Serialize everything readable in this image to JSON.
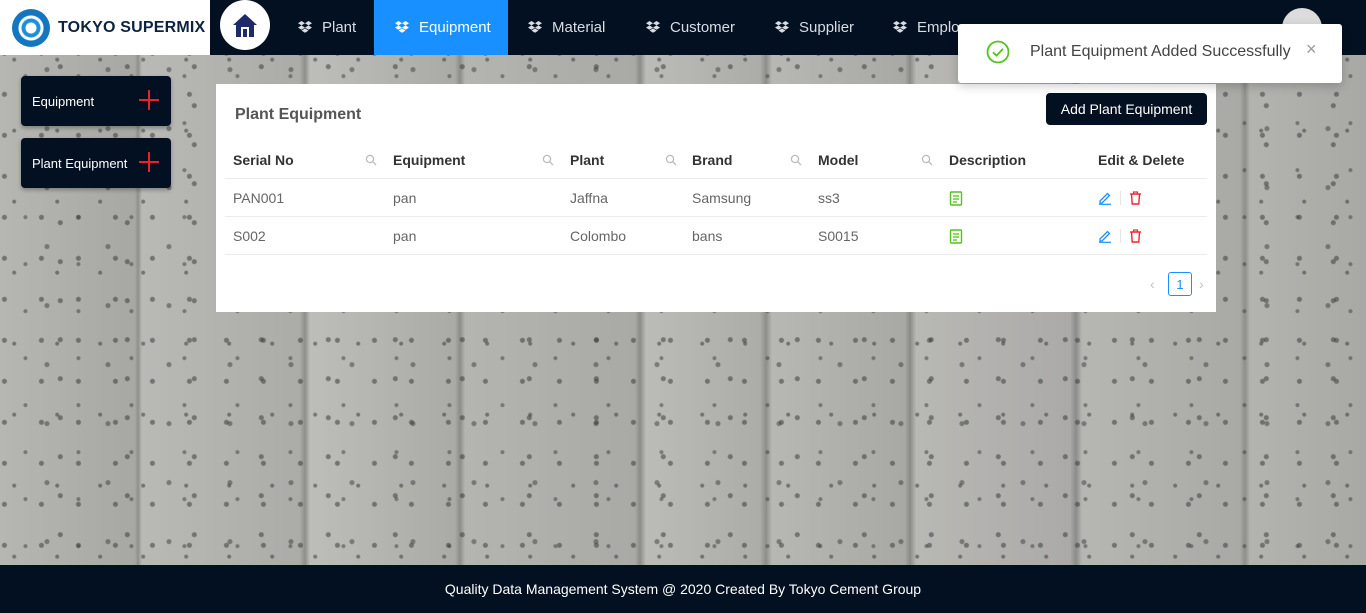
{
  "brand": {
    "name": "TOKYO SUPERMIX"
  },
  "nav": {
    "items": [
      {
        "label": "Plant",
        "icon": "dropbox-icon"
      },
      {
        "label": "Equipment",
        "icon": "dropbox-icon",
        "active": true
      },
      {
        "label": "Material",
        "icon": "dropbox-icon"
      },
      {
        "label": "Customer",
        "icon": "dropbox-icon"
      },
      {
        "label": "Supplier",
        "icon": "dropbox-icon"
      },
      {
        "label": "Emplo",
        "icon": "dropbox-icon"
      }
    ]
  },
  "sidebar": {
    "buttons": [
      {
        "label": "Equipment",
        "icon": "plus-icon"
      },
      {
        "label": "Plant Equipment",
        "icon": "plus-icon"
      }
    ]
  },
  "card": {
    "title": "Plant Equipment",
    "add_button": "Add Plant Equipment"
  },
  "table": {
    "columns": [
      "Serial No",
      "Equipment",
      "Plant",
      "Brand",
      "Model",
      "Description",
      "Edit & Delete"
    ],
    "rows": [
      {
        "serial": "PAN001",
        "equipment": "pan",
        "plant": "Jaffna",
        "brand": "Samsung",
        "model": "ss3"
      },
      {
        "serial": "S002",
        "equipment": "pan",
        "plant": "Colombo",
        "brand": "bans",
        "model": "S0015"
      }
    ]
  },
  "pagination": {
    "current": "1"
  },
  "toast": {
    "message": "Plant Equipment Added Successfully"
  },
  "footer": {
    "text": "Quality Data Management System @ 2020 Created By Tokyo Cement Group"
  },
  "colors": {
    "navy": "#031021",
    "accent": "#1890ff",
    "success": "#52c41a",
    "danger": "#f5222d",
    "plus": "#e8222a"
  }
}
